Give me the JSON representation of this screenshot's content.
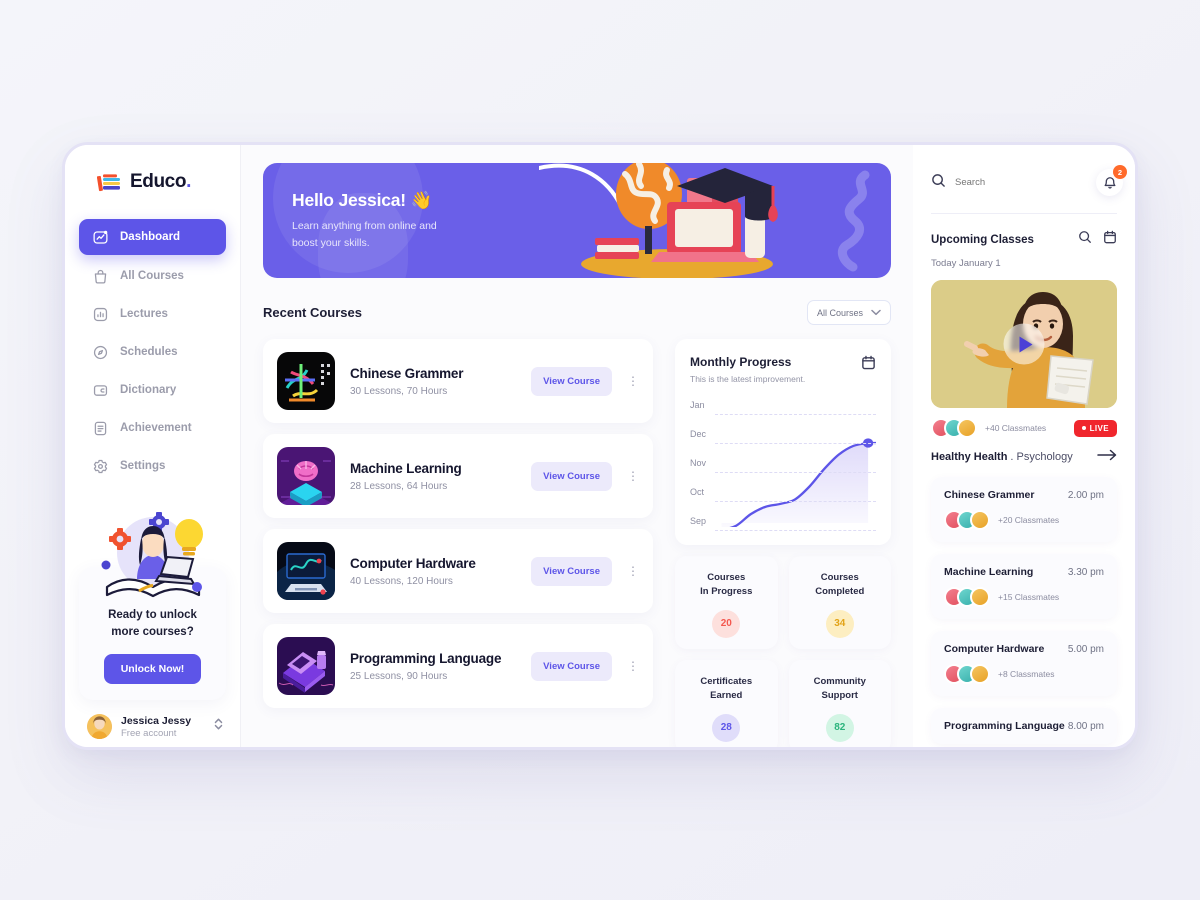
{
  "brand": {
    "name": "Educo",
    "dot": ".",
    "logo_icon": "books-logo-icon"
  },
  "sidebar": {
    "items": [
      {
        "label": "Dashboard",
        "icon": "dashboard-icon",
        "active": true
      },
      {
        "label": "All Courses",
        "icon": "bag-icon",
        "active": false
      },
      {
        "label": "Lectures",
        "icon": "bar-chart-icon",
        "active": false
      },
      {
        "label": "Schedules",
        "icon": "compass-icon",
        "active": false
      },
      {
        "label": "Dictionary",
        "icon": "book-card-icon",
        "active": false
      },
      {
        "label": "Achievement",
        "icon": "document-icon",
        "active": false
      },
      {
        "label": "Settings",
        "icon": "gear-icon",
        "active": false
      }
    ],
    "promo": {
      "title_line1": "Ready to unlock",
      "title_line2": "more courses?",
      "button_label": "Unlock Now!",
      "illustration": "woman-laptop-book-illustration"
    },
    "user": {
      "name": "Jessica Jessy",
      "plan": "Free account",
      "avatar": "user-avatar",
      "switcher_icon": "updown-chevron-icon"
    }
  },
  "hero": {
    "greeting": "Hello Jessica! 👋",
    "subtitle_line1": "Learn anything from online and",
    "subtitle_line2": "boost your skills.",
    "bg_color": "#6a5fe8",
    "illustration": "globe-laptop-graduation-cap-illustration"
  },
  "recent": {
    "title": "Recent Courses",
    "filter_value": "All Courses",
    "filter_icon": "chevron-down-icon",
    "view_label": "View Course",
    "courses": [
      {
        "name": "Chinese Grammer",
        "meta": "30 Lessons, 70 Hours",
        "thumb": "chinese-calligraphy-thumb"
      },
      {
        "name": "Machine Learning",
        "meta": "28 Lessons, 64 Hours",
        "thumb": "brain-cube-thumb"
      },
      {
        "name": "Computer Hardware",
        "meta": "40 Lessons, 120 Hours",
        "thumb": "monitor-thumb"
      },
      {
        "name": "Programming Language",
        "meta": "25 Lessons, 90 Hours",
        "thumb": "laptop-code-thumb"
      }
    ]
  },
  "progress": {
    "title": "Monthly Progress",
    "subtitle": "This is the latest improvement.",
    "calendar_icon": "calendar-icon"
  },
  "chart_data": {
    "type": "area",
    "title": "Monthly Progress",
    "subtitle": "This is the latest improvement.",
    "xlabel": "",
    "ylabel": "",
    "grid": true,
    "legend": false,
    "ytick_labels": [
      "Jan",
      "Dec",
      "Nov",
      "Oct",
      "Sep"
    ],
    "ytick_values": [
      5,
      4,
      3,
      2,
      1
    ],
    "x": [
      0,
      1,
      2,
      3,
      4,
      5,
      6,
      7,
      8,
      9,
      10
    ],
    "values": [
      1.0,
      1.15,
      1.55,
      1.8,
      1.9,
      2.05,
      2.5,
      3.1,
      3.6,
      3.9,
      4.0
    ],
    "line_color": "#5d55e8",
    "fill_color": "#ded9fa",
    "end_point": {
      "x": 10,
      "y": 4.0,
      "label": "Dec"
    }
  },
  "stats": [
    {
      "label_line1": "Courses",
      "label_line2": "In Progress",
      "value": "20",
      "bg": "#fde0dd",
      "fg": "#f4584f"
    },
    {
      "label_line1": "Courses",
      "label_line2": "Completed",
      "value": "34",
      "bg": "#fdeec1",
      "fg": "#e2a317"
    },
    {
      "label_line1": "Certificates",
      "label_line2": "Earned",
      "value": "28",
      "bg": "#e0ddfa",
      "fg": "#5d55e8"
    },
    {
      "label_line1": "Community",
      "label_line2": "Support",
      "value": "82",
      "bg": "#d2f5e4",
      "fg": "#2bb47d"
    }
  ],
  "rightpanel": {
    "search_placeholder": "Search",
    "search_icon": "search-icon",
    "bell_icon": "bell-icon",
    "bell_count": "2",
    "upcoming_title": "Upcoming Classes",
    "upcoming_search_icon": "search-icon",
    "upcoming_calendar_icon": "calendar-icon",
    "today": "Today January 1",
    "video": {
      "thumbnail": "teacher-pointing-thumbnail",
      "play_icon": "play-icon",
      "classmates": "+40 Classmates",
      "live_label": "LIVE"
    },
    "featured": {
      "name": "Healthy Health",
      "separator": ".",
      "category": "Psychology",
      "arrow_icon": "arrow-right-icon"
    },
    "classes": [
      {
        "name": "Chinese Grammer",
        "time": "2.00 pm",
        "classmates": "+20 Classmates"
      },
      {
        "name": "Machine Learning",
        "time": "3.30 pm",
        "classmates": "+15 Classmates"
      },
      {
        "name": "Computer Hardware",
        "time": "5.00 pm",
        "classmates": "+8 Classmates"
      },
      {
        "name": "Programming Language",
        "time": "8.00 pm",
        "classmates": ""
      }
    ]
  }
}
